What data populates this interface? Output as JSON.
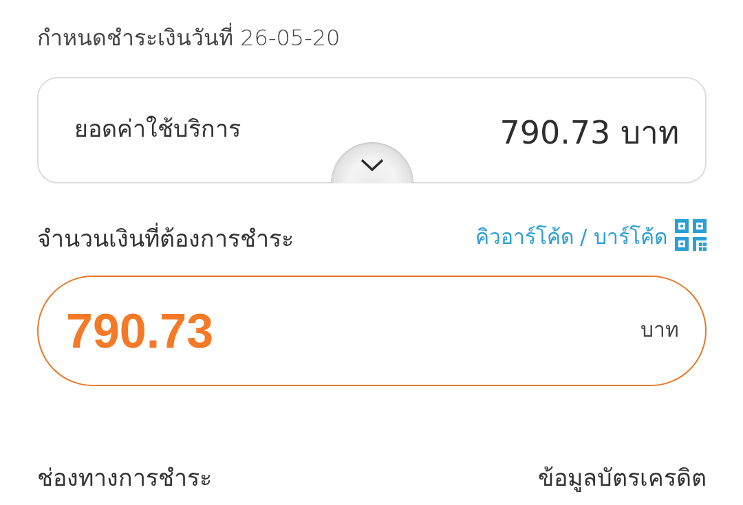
{
  "due_date": "กำหนดชำระเงินวันที่ 26-05-20",
  "bill_card": {
    "label": "ยอดค่าใช้บริการ",
    "amount": "790.73 บาท",
    "expanded": false
  },
  "payment_amount": {
    "label": "จำนวนเงินที่ต้องการชำระ",
    "qr_link": "คิวอาร์โค้ด / บาร์โค้ด",
    "value": "790.73",
    "unit": "บาท"
  },
  "payment_channel": {
    "label": "ช่องทางการชำระ",
    "value": "ข้อมูลบัตรเครดิต"
  }
}
